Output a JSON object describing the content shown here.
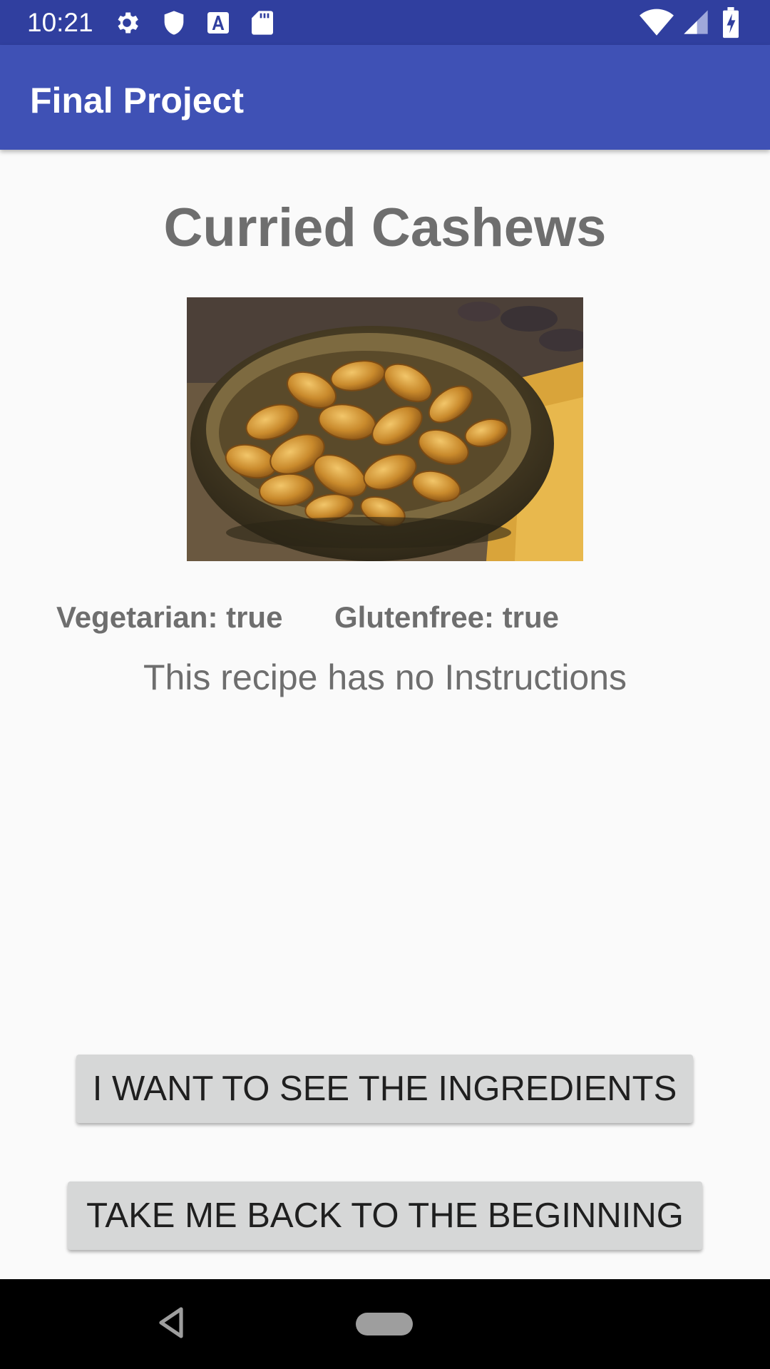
{
  "status_bar": {
    "time": "10:21",
    "left_icons": [
      "gear-icon",
      "shield-icon",
      "font-a-icon",
      "sd-card-icon"
    ],
    "right_icons": [
      "wifi-icon",
      "signal-icon",
      "battery-charging-icon"
    ]
  },
  "app_bar": {
    "title": "Final Project"
  },
  "recipe": {
    "title": "Curried Cashews",
    "vegetarian": "Vegetarian: true",
    "glutenfree": "Glutenfree: true",
    "instructions": "This recipe has no Instructions"
  },
  "buttons": {
    "ingredients": "I WANT TO SEE THE INGREDIENTS",
    "back": "TAKE ME BACK TO THE BEGINNING"
  },
  "nav_bar": {
    "icons": [
      "back-triangle-icon",
      "home-pill-icon"
    ]
  },
  "colors": {
    "status_bar": "#303f9f",
    "app_bar": "#3f51b5",
    "text_gray": "#6e6e6e",
    "button_bg": "#d6d7d7"
  }
}
